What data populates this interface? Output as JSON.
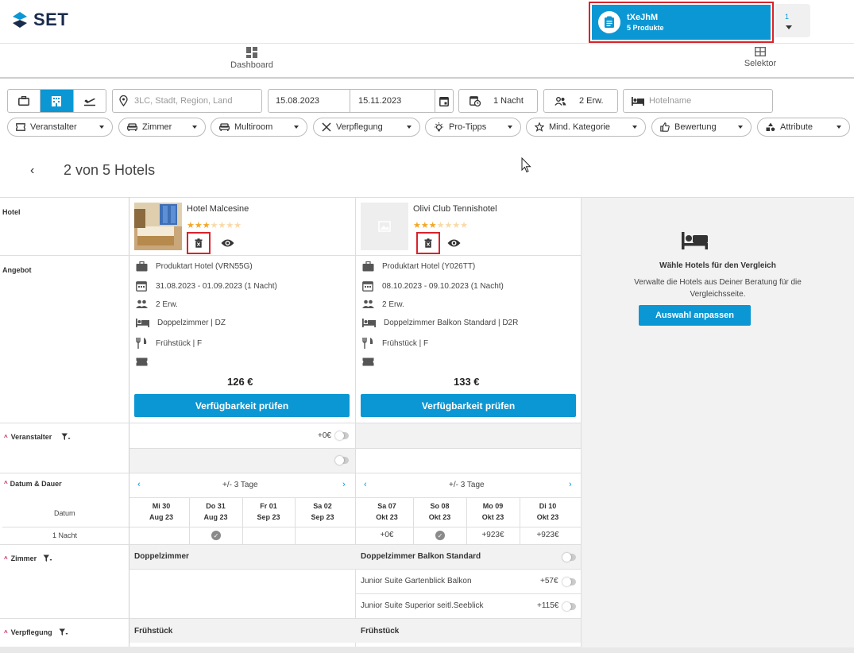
{
  "brand": {
    "name": "SET",
    "accent": "#0b97d3",
    "highlight": "#d8232a"
  },
  "basket": {
    "title": "tXeJhM",
    "subtitle": "5 Produkte",
    "count": "1"
  },
  "nav": {
    "dashboard": "Dashboard",
    "selector": "Selektor"
  },
  "search": {
    "location_placeholder": "3LC, Stadt, Region, Land",
    "date_from": "15.08.2023",
    "date_to": "15.11.2023",
    "nights": "1 Nacht",
    "travellers": "2 Erw.",
    "hotelname_placeholder": "Hotelname"
  },
  "filters": [
    "Veranstalter",
    "Zimmer",
    "Multiroom",
    "Verpflegung",
    "Pro-Tipps",
    "Mind. Kategorie",
    "Bewertung",
    "Attribute"
  ],
  "compare": {
    "count_label": "2 von 5 Hotels"
  },
  "row_labels": {
    "hotel": "Hotel",
    "offer": "Angebot",
    "operator": "Veranstalter",
    "date_duration": "Datum & Dauer",
    "date": "Datum",
    "duration": "1 Nacht",
    "room": "Zimmer",
    "board": "Verpflegung"
  },
  "hotels": [
    {
      "name": "Hotel Malcesine",
      "stars": 3,
      "product": "Produktart Hotel (VRN55G)",
      "dates": "31.08.2023 - 01.09.2023 (1 Nacht)",
      "travellers": "2 Erw.",
      "room": "Doppelzimmer | DZ",
      "board": "Frühstück | F",
      "price": "126 €",
      "cta": "Verfügbarkeit prüfen",
      "operator_price": "+0€",
      "flex_label": "+/- 3 Tage",
      "days": [
        {
          "d": "Mi 30",
          "m": "Aug 23",
          "v": ""
        },
        {
          "d": "Do 31",
          "m": "Aug 23",
          "v": "check"
        },
        {
          "d": "Fr 01",
          "m": "Sep 23",
          "v": ""
        },
        {
          "d": "Sa 02",
          "m": "Sep 23",
          "v": ""
        }
      ],
      "room_header": "Doppelzimmer",
      "room_options": [],
      "board_header": "Frühstück"
    },
    {
      "name": "Olivi Club Tennishotel",
      "stars": 3,
      "product": "Produktart Hotel (Y026TT)",
      "dates": "08.10.2023 - 09.10.2023 (1 Nacht)",
      "travellers": "2 Erw.",
      "room": "Doppelzimmer Balkon Standard | D2R",
      "board": "Frühstück | F",
      "price": "133 €",
      "cta": "Verfügbarkeit prüfen",
      "operator_price": "",
      "flex_label": "+/- 3 Tage",
      "days": [
        {
          "d": "Sa 07",
          "m": "Okt 23",
          "v": "+0€"
        },
        {
          "d": "So 08",
          "m": "Okt 23",
          "v": "check"
        },
        {
          "d": "Mo 09",
          "m": "Okt 23",
          "v": "+923€"
        },
        {
          "d": "Di 10",
          "m": "Okt 23",
          "v": "+923€"
        }
      ],
      "room_header": "Doppelzimmer Balkon Standard",
      "room_options": [
        {
          "name": "Junior Suite Gartenblick Balkon",
          "price": "+57€"
        },
        {
          "name": "Junior Suite Superior seitl.Seeblick",
          "price": "+115€"
        }
      ],
      "board_header": "Frühstück"
    }
  ],
  "empty_slot": {
    "title": "Wähle Hotels für den Vergleich",
    "text": "Verwalte die Hotels aus Deiner Beratung für die Vergleichsseite.",
    "button": "Auswahl anpassen"
  }
}
